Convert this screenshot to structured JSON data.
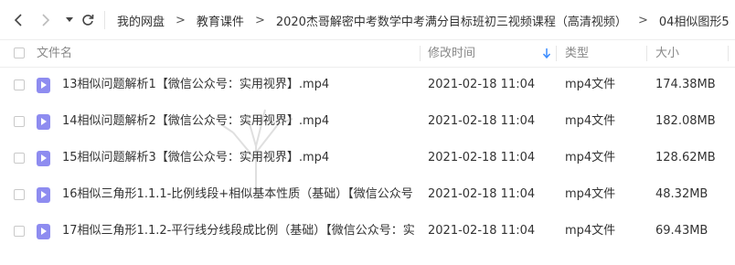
{
  "nav": {
    "breadcrumbs": [
      "我的网盘",
      "教育课件",
      "2020杰哥解密中考数学中考满分目标班初三视频课程（高清视频）",
      "04相似图形5"
    ],
    "separator": ">"
  },
  "columns": {
    "name": "文件名",
    "modified": "修改时间",
    "type": "类型",
    "size": "大小"
  },
  "files": [
    {
      "name": "13相似问题解析1【微信公众号：实用视界】.mp4",
      "modified": "2021-02-18 11:04",
      "type": "mp4文件",
      "size": "174.38MB"
    },
    {
      "name": "14相似问题解析2【微信公众号：实用视界】.mp4",
      "modified": "2021-02-18 11:04",
      "type": "mp4文件",
      "size": "182.08MB"
    },
    {
      "name": "15相似问题解析3【微信公众号：实用视界】.mp4",
      "modified": "2021-02-18 11:04",
      "type": "mp4文件",
      "size": "128.62MB"
    },
    {
      "name": "16相似三角形1.1.1-比例线段+相似基本性质（基础）【微信公众号：...",
      "modified": "2021-02-18 11:04",
      "type": "mp4文件",
      "size": "48.32MB"
    },
    {
      "name": "17相似三角形1.1.2-平行线分线段成比例（基础）【微信公众号：实用...",
      "modified": "2021-02-18 11:04",
      "type": "mp4文件",
      "size": "69.43MB"
    }
  ],
  "colors": {
    "accent": "#3b8cff",
    "file_icon": "#8e8cf0"
  }
}
